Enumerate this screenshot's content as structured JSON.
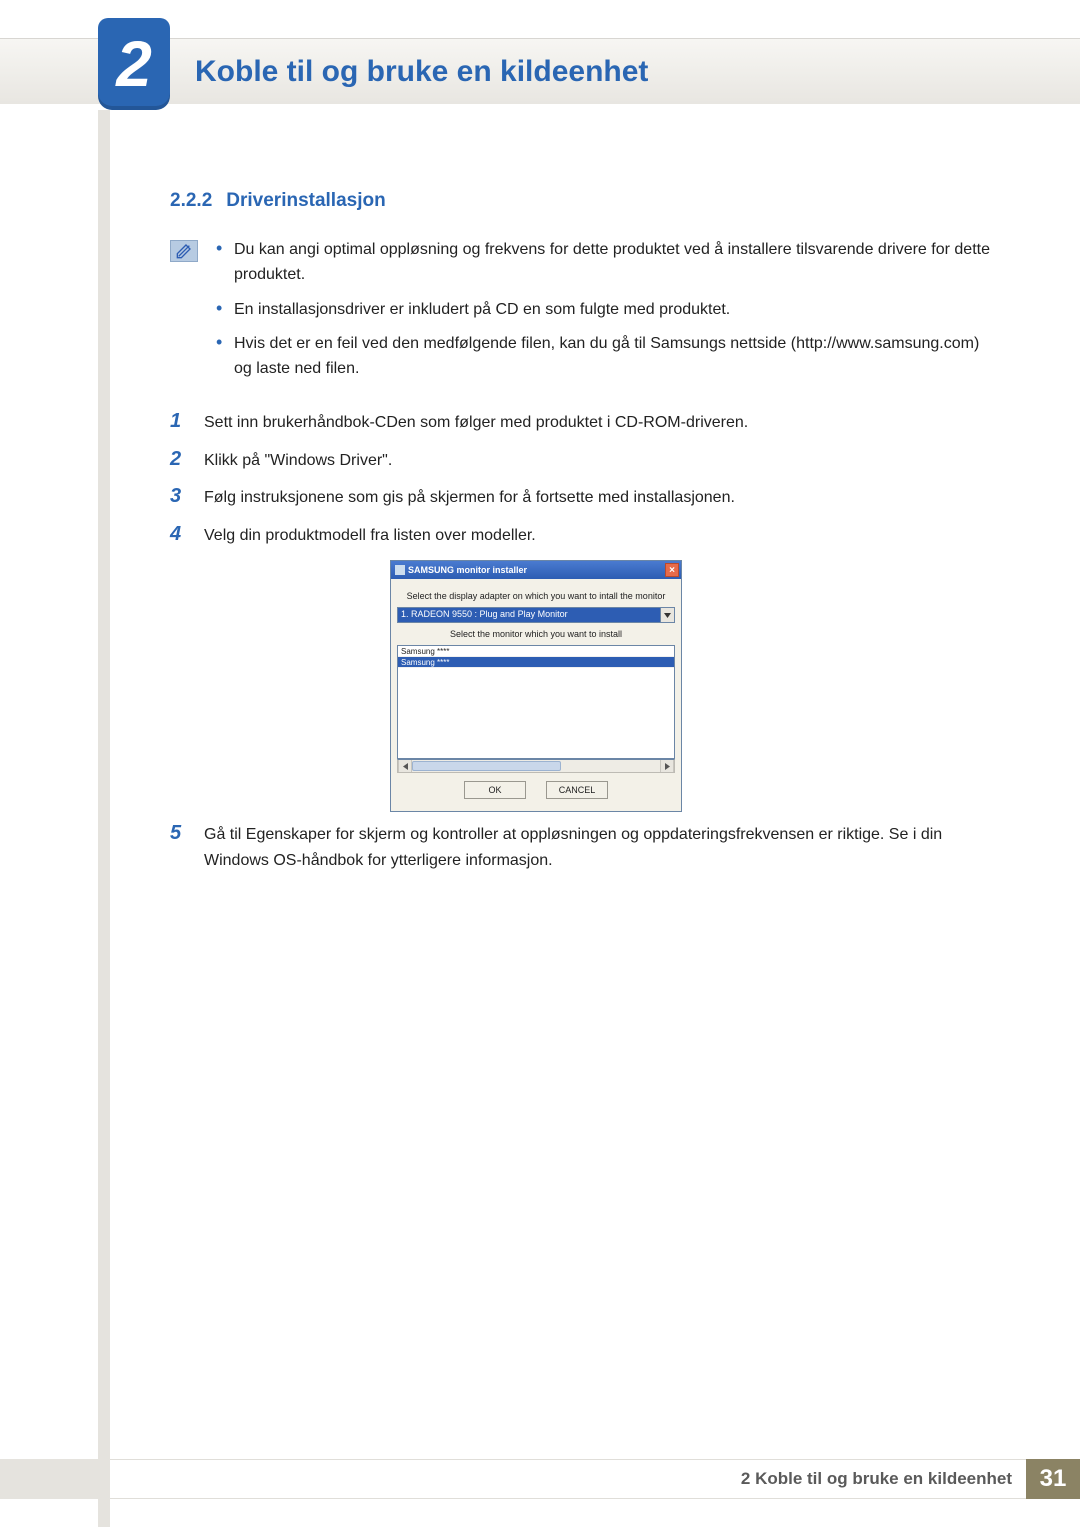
{
  "chapter": {
    "number": "2",
    "title": "Koble til og bruke en kildeenhet"
  },
  "section": {
    "number": "2.2.2",
    "title": "Driverinstallasjon"
  },
  "notes": [
    "Du kan angi optimal oppløsning og frekvens for dette produktet ved å installere tilsvarende drivere for dette produktet.",
    "En installasjonsdriver er inkludert på CD en som fulgte med produktet.",
    "Hvis det er en feil ved den medfølgende filen, kan du gå til Samsungs nettside (http://www.samsung.com) og laste ned filen."
  ],
  "steps": [
    "Sett inn brukerhåndbok-CDen som følger med produktet i CD-ROM-driveren.",
    "Klikk på \"Windows Driver\".",
    "Følg instruksjonene som gis på skjermen for å fortsette med installasjonen.",
    "Velg din produktmodell fra listen over modeller.",
    "Gå til Egenskaper for skjerm og kontroller at oppløsningen og oppdateringsfrekvensen er riktige. Se i din Windows OS-håndbok for ytterligere informasjon."
  ],
  "step_numbers": [
    "1",
    "2",
    "3",
    "4",
    "5"
  ],
  "dialog": {
    "title": "SAMSUNG monitor installer",
    "instruction1": "Select the display adapter on which you want to intall the monitor",
    "adapter_value": "1. RADEON 9550 : Plug and Play Monitor",
    "instruction2": "Select the monitor which you want to install",
    "list_items": [
      "Samsung ****",
      "Samsung ****"
    ],
    "ok": "OK",
    "cancel": "CANCEL"
  },
  "footer": {
    "title": "2 Koble til og bruke en kildeenhet",
    "page": "31"
  }
}
